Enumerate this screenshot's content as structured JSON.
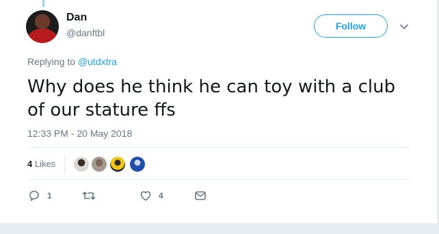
{
  "user": {
    "name": "Dan",
    "handle": "@danftbl"
  },
  "follow": {
    "label": "Follow"
  },
  "reply": {
    "prefix": "Replying to ",
    "mention": "@utdxtra"
  },
  "tweet": {
    "text": "Why does he think he can toy with a club of our stature ffs",
    "timestamp": "12:33 PM - 20 May 2018"
  },
  "stats": {
    "likes_count": "4",
    "likes_label": "Likes"
  },
  "actions": {
    "replies": "1",
    "retweets": "",
    "likes": "4"
  },
  "icons": [
    "chevron-down-icon",
    "reply-icon",
    "retweet-icon",
    "heart-icon",
    "envelope-icon"
  ],
  "colors": {
    "accent": "#1da1f2",
    "secondary_text": "#657786",
    "primary_text": "#14171a",
    "divider": "#e6ecf0"
  }
}
